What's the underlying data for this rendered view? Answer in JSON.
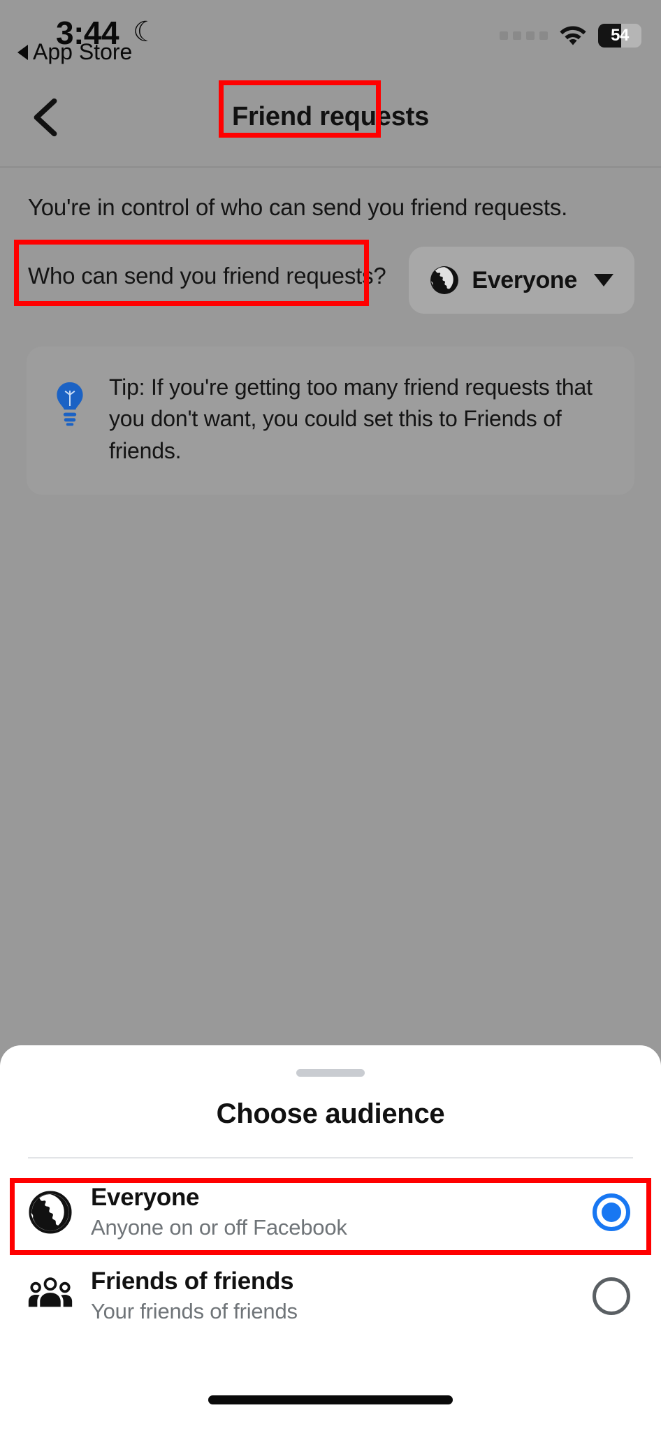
{
  "status_bar": {
    "time": "3:44",
    "moon_icon": "crescent-moon-icon",
    "back_app_label": "App Store",
    "signal_icon": "signal-dots-icon",
    "wifi_icon": "wifi-icon",
    "battery_level": "54",
    "battery_percent": 54
  },
  "nav": {
    "back_icon": "chevron-left-icon",
    "title": "Friend requests"
  },
  "main": {
    "intro_text": "You're in control of who can send you friend requests.",
    "question_label": "Who can send you friend requests?",
    "audience_value": "Everyone",
    "audience_icon": "globe-icon",
    "caret_icon": "chevron-down-icon",
    "tip_icon": "lightbulb-icon",
    "tip_text": "Tip: If you're getting too many friend requests that you don't want, you could set this to Friends of friends."
  },
  "sheet": {
    "grabber": "drag-handle",
    "title": "Choose audience",
    "options": [
      {
        "icon": "globe-icon",
        "title": "Everyone",
        "subtitle": "Anyone on or off Facebook",
        "selected": true
      },
      {
        "icon": "people-group-icon",
        "title": "Friends of friends",
        "subtitle": "Your friends of friends",
        "selected": false
      }
    ]
  },
  "annotations": {
    "highlight_color": "#ff0000",
    "boxes": [
      "Friend requests",
      "Who can send you friend requests?",
      "Everyone"
    ]
  },
  "colors": {
    "dimmed_background": "#999999",
    "pill_background": "#a8a8a8",
    "tip_background": "#9d9d9d",
    "sheet_background": "#ffffff",
    "accent_blue": "#1877f2",
    "subtitle_gray": "#6f7478"
  }
}
